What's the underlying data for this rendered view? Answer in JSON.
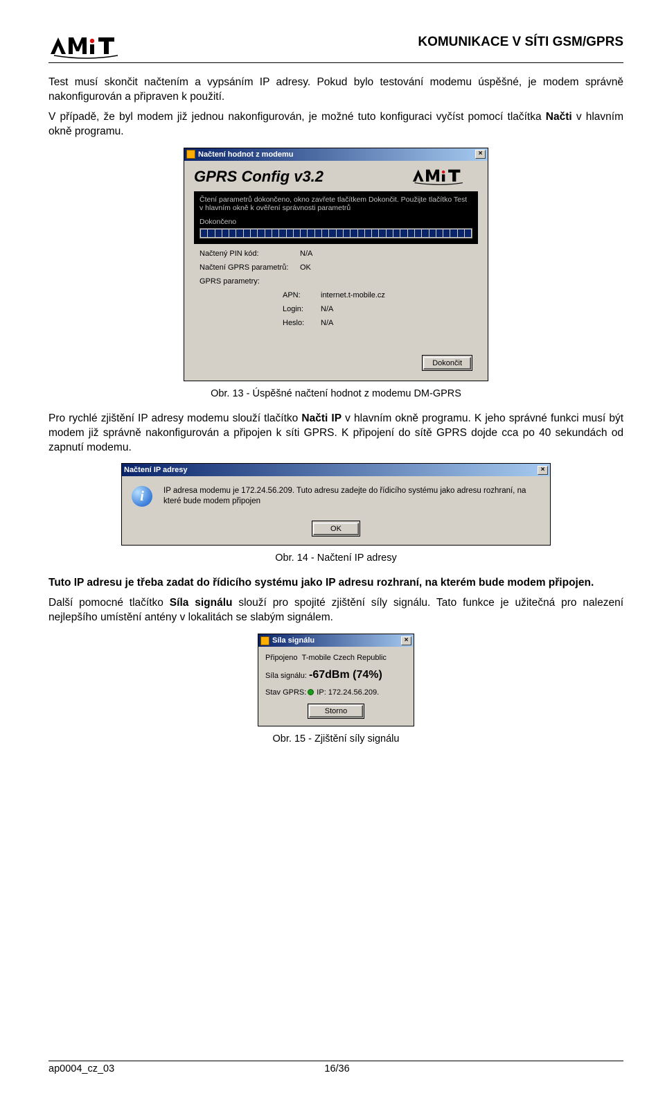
{
  "header": {
    "title": "KOMUNIKACE V SÍTI GSM/GPRS"
  },
  "p1": "Test musí skončit načtením a vypsáním IP adresy. Pokud bylo testování modemu úspěšné, je modem správně nakonfigurován a připraven k použití.",
  "p2a": "V případě, že byl modem již jednou nakonfigurován, je možné tuto konfiguraci vyčíst pomocí tlačítka ",
  "p2b": "Načti",
  "p2c": " v hlavním okně programu.",
  "cap13": "Obr. 13 -  Úspěšné načtení hodnot z modemu DM-GPRS",
  "p3a": "Pro rychlé zjištění IP adresy modemu slouží tlačítko ",
  "p3b": "Načti IP",
  "p3c": " v hlavním okně programu. K jeho správné funkci musí být modem již správně nakonfigurován a připojen k síti GPRS. K připojení do sítě GPRS dojde cca po 40 sekundách od zapnutí modemu.",
  "cap14": "Obr. 14 -  Načtení IP adresy",
  "p4": "Tuto IP adresu je třeba zadat do řídicího systému jako IP adresu rozhraní, na kterém bude modem připojen.",
  "p5a": "Další pomocné tlačítko ",
  "p5b": "Síla signálu",
  "p5c": " slouží pro spojité zjištění síly signálu. Tato funkce je užitečná pro nalezení nejlepšího umístění antény v lokalitách se slabým signálem.",
  "cap15": "Obr. 15 -  Zjištění síly signálu",
  "footer": {
    "left": "ap0004_cz_03",
    "right": "16/36"
  },
  "dlg1": {
    "title": "Načtení hodnot z modemu",
    "bigtitle": "GPRS Config v3.2",
    "bb1": "Čtení parametrů dokončeno, okno zavřete tlačítkem Dokončit. Použijte tlačítko Test v hlavním okně k ověření správnosti parametrů",
    "bb2": "Dokončeno",
    "r1l": "Načtený PIN kód:",
    "r1v": "N/A",
    "r2l": "Načtení GPRS parametrů:",
    "r2v": "OK",
    "gp": "GPRS parametry:",
    "apnl": "APN:",
    "apnv": "internet.t-mobile.cz",
    "logl": "Login:",
    "logv": "N/A",
    "hesl": "Heslo:",
    "hesv": "N/A",
    "btn": "Dokončit"
  },
  "dlg2": {
    "title": "Načtení IP adresy",
    "msg": "IP adresa modemu je 172.24.56.209. Tuto adresu zadejte do řídicího systému jako adresu rozhraní, na které bude modem připojen",
    "ok": "OK"
  },
  "dlg3": {
    "title": "Síla signálu",
    "r1l": "Připojeno",
    "r1v": "T-mobile Czech Republic",
    "r2l": "Síla signálu:",
    "r2v": "-67dBm (74%)",
    "r3l": "Stav GPRS:",
    "r3v": "IP: 172.24.56.209.",
    "btn": "Storno"
  }
}
